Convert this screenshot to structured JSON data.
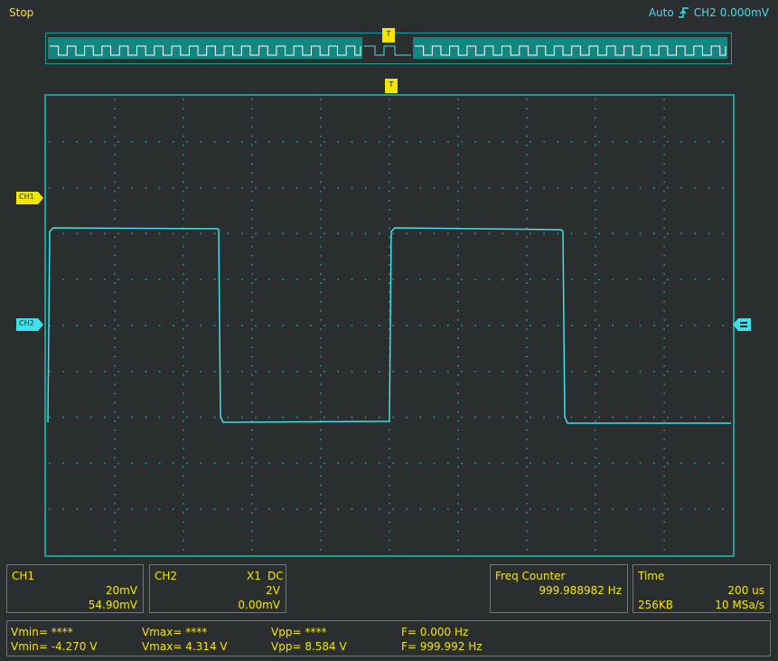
{
  "status": "Stop",
  "trigger": {
    "mode": "Auto",
    "source": "CH2",
    "level": "0.000mV"
  },
  "markers": {
    "trigger": "T",
    "ch1": "CH1",
    "ch2": "CH2"
  },
  "channels": {
    "ch1": {
      "name": "CH1",
      "scale": "20mV",
      "offset": "54.90mV"
    },
    "ch2": {
      "name": "CH2",
      "probe": "X1",
      "coupling": "DC",
      "scale": "2V",
      "offset": "0.00mV"
    }
  },
  "freq_counter": {
    "title": "Freq Counter",
    "value": "999.988982 Hz"
  },
  "time": {
    "title": "Time",
    "scale": "200 us",
    "memory": "256KB",
    "rate": "10 MSa/s"
  },
  "measurements": {
    "row1": {
      "vmin": "Vmin= ****",
      "vmax": "Vmax= ****",
      "vpp": "Vpp= ****",
      "f": "F= 0.000 Hz"
    },
    "row2": {
      "vmin": "Vmin= -4.270 V",
      "vmax": "Vmax= 4.314 V",
      "vpp": "Vpp= 8.584 V",
      "f": "F= 999.992 Hz"
    }
  },
  "colors": {
    "ch1": "#f2e600",
    "ch2": "#3fe0e8",
    "grid": "#1c9e98",
    "text": "#f2e600"
  }
}
